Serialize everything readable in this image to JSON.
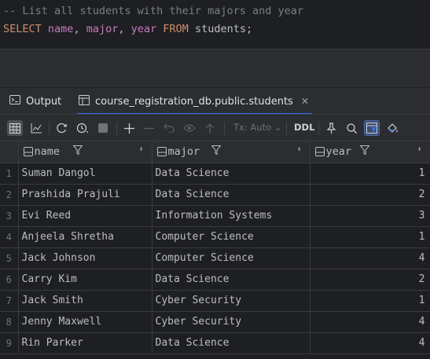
{
  "editor": {
    "comment": "-- List all students with their majors and year",
    "sql": {
      "select": "SELECT",
      "col1": "name",
      "comma1": ",",
      "col2": "major",
      "comma2": ",",
      "col3": "year",
      "from": "FROM",
      "table": "students;"
    }
  },
  "tabs": {
    "output": "Output",
    "results": "course_registration_db.public.students"
  },
  "toolbar": {
    "tx_mode": "Tx: Auto",
    "ddl": "DDL"
  },
  "grid": {
    "columns": [
      "name",
      "major",
      "year"
    ],
    "rows": [
      {
        "n": "1",
        "name": "Suman Dangol",
        "major": "Data Science",
        "year": "1"
      },
      {
        "n": "2",
        "name": "Prashida Prajuli",
        "major": "Data Science",
        "year": "2"
      },
      {
        "n": "3",
        "name": "Evi Reed",
        "major": "Information Systems",
        "year": "3"
      },
      {
        "n": "4",
        "name": "Anjeela Shretha",
        "major": "Computer Science",
        "year": "1"
      },
      {
        "n": "5",
        "name": "Jack Johnson",
        "major": "Computer Science",
        "year": "4"
      },
      {
        "n": "6",
        "name": "Carry Kim",
        "major": "Data Science",
        "year": "2"
      },
      {
        "n": "7",
        "name": "Jack Smith",
        "major": "Cyber Security",
        "year": "1"
      },
      {
        "n": "8",
        "name": "Jenny Maxwell",
        "major": "Cyber Security",
        "year": "4"
      },
      {
        "n": "9",
        "name": "Rin Parker",
        "major": "Data Science",
        "year": "4"
      }
    ]
  }
}
